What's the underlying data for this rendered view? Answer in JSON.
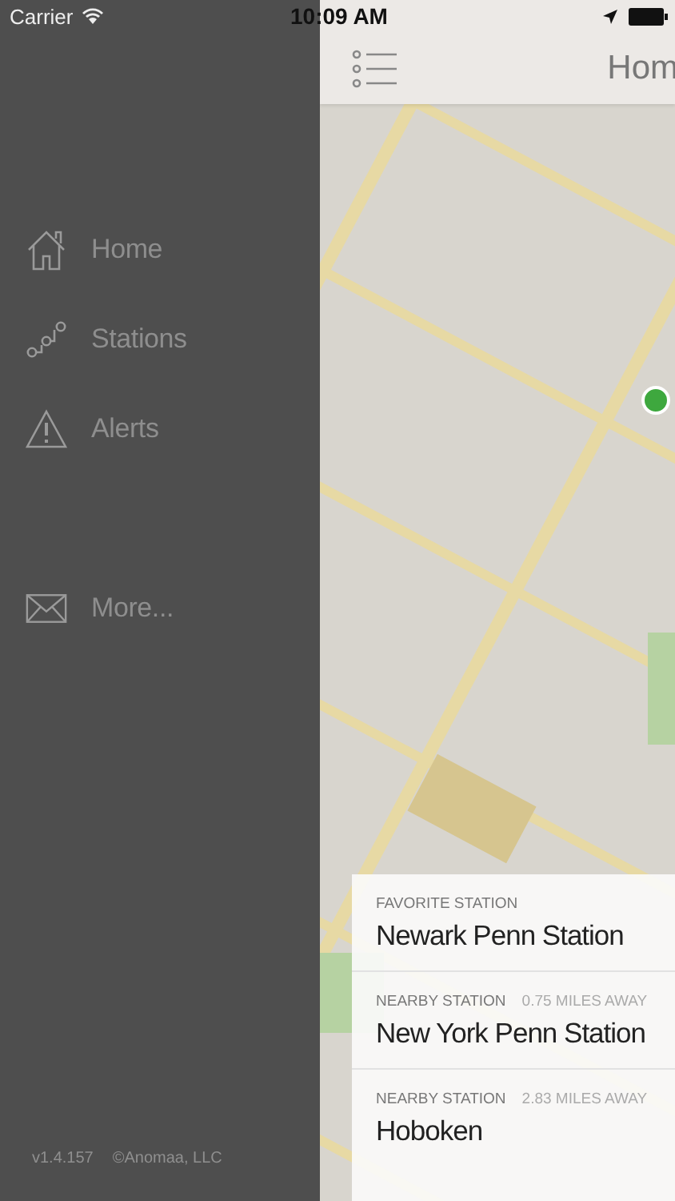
{
  "status_bar": {
    "carrier": "Carrier",
    "time": "10:09 AM"
  },
  "nav_bar": {
    "title": "Hom"
  },
  "menu": {
    "items": [
      {
        "label": "Home",
        "kind": "home"
      },
      {
        "label": "Stations",
        "kind": "route"
      },
      {
        "label": "Alerts",
        "kind": "alert"
      },
      {
        "label": "More...",
        "kind": "mail"
      }
    ]
  },
  "footer": {
    "version": "v1.4.157",
    "copyright": "©Anomaa, LLC"
  },
  "stations": [
    {
      "category": "FAVORITE STATION",
      "title": "Newark Penn Station"
    },
    {
      "category": "NEARBY STATION",
      "distance": "0.75 MILES AWAY",
      "title": "New York Penn Station"
    },
    {
      "category": "NEARBY STATION",
      "distance": "2.83 MILES AWAY",
      "title": "Hoboken"
    }
  ]
}
